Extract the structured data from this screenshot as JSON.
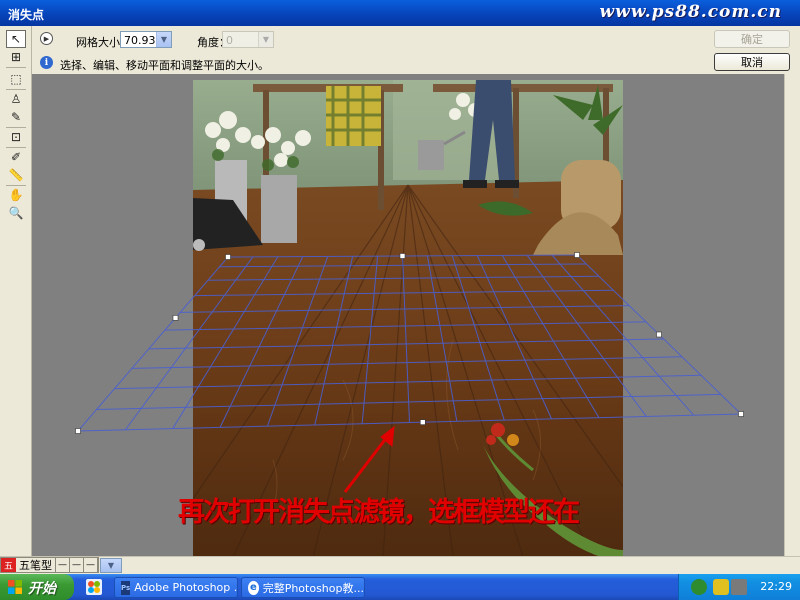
{
  "window": {
    "title": "消失点",
    "watermark": "www.ps88.com.cn"
  },
  "tools": [
    {
      "name": "edit-plane-tool",
      "glyph": "↖",
      "active": true
    },
    {
      "name": "create-plane-tool",
      "glyph": "⊞",
      "active": false
    },
    {
      "name": "marquee-tool",
      "glyph": "⬚",
      "active": false
    },
    {
      "name": "stamp-tool",
      "glyph": "♙",
      "active": false
    },
    {
      "name": "brush-tool",
      "glyph": "✎",
      "active": false
    },
    {
      "name": "transform-tool",
      "glyph": "⊡",
      "active": false
    },
    {
      "name": "eyedropper-tool",
      "glyph": "✐",
      "active": false
    },
    {
      "name": "measure-tool",
      "glyph": "📏",
      "active": false
    },
    {
      "name": "hand-tool",
      "glyph": "✋",
      "active": false
    },
    {
      "name": "zoom-tool",
      "glyph": "🔍",
      "active": false
    }
  ],
  "options": {
    "grid_size_label": "网格大小：",
    "grid_size_value": "70.93",
    "angle_label": "角度：",
    "angle_value": "0"
  },
  "info": {
    "text": "选择、编辑、移动平面和调整平面的大小。"
  },
  "buttons": {
    "ok": "确定",
    "cancel": "取消"
  },
  "annotation": {
    "text": "再次打开消失点滤镜，选框模型还在",
    "color": "#e00000"
  },
  "ime": {
    "name": "五笔型",
    "logo": "五"
  },
  "taskbar": {
    "start_label": "开始",
    "tasks": [
      {
        "label": "Adobe Photoshop ...",
        "icon": "Ps",
        "active": false
      },
      {
        "label": "完整Photoshop教...",
        "icon": "e",
        "active": false
      }
    ],
    "clock": "22:29"
  },
  "colors": {
    "xp_blue": "#245edb",
    "start_green": "#3c9a34",
    "grid_line": "#4a5fd0"
  }
}
